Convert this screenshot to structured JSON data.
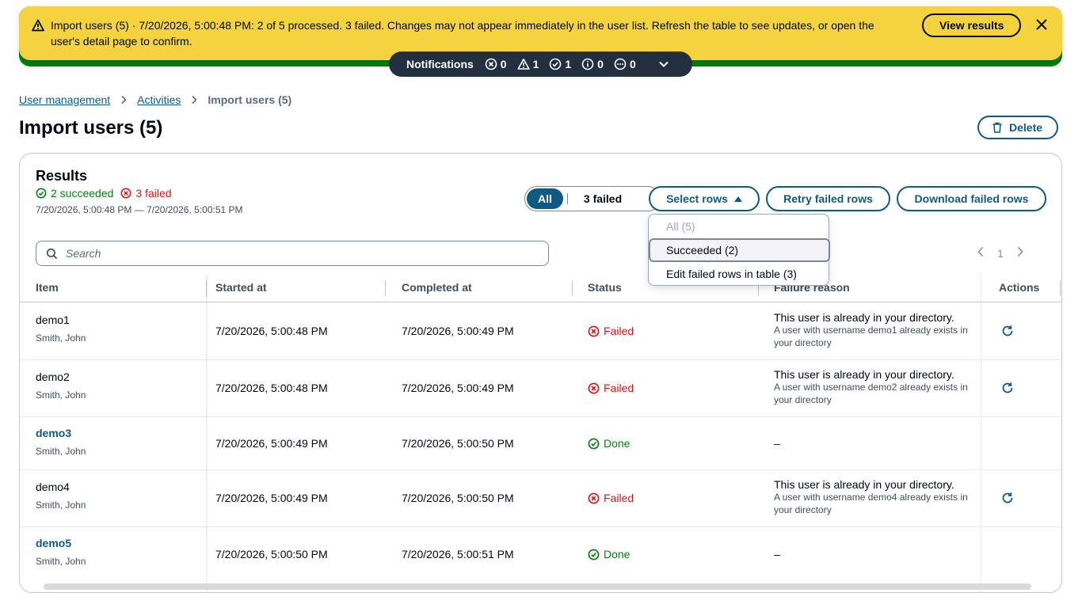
{
  "flash": {
    "text": "Import users (5) · 7/20/2026, 5:00:48 PM: 2 of 5 processed. 3 failed. Changes may not appear immediately in the user list. Refresh the table to see updates, or open the user's detail page to confirm.",
    "action_label": "View results",
    "icon": "warning-icon",
    "background": "#f5d33f"
  },
  "notifications": {
    "label": "Notifications",
    "counts": {
      "error": "0",
      "warning": "1",
      "success": "1",
      "info": "0",
      "in_progress": "0"
    }
  },
  "breadcrumb": {
    "items": [
      "User management",
      "Activities"
    ],
    "current": "Import users (5)"
  },
  "page": {
    "title": "Import users (5)",
    "delete_label": "Delete"
  },
  "results": {
    "title": "Results",
    "succeeded": "2 succeeded",
    "failed": "3 failed",
    "range": "7/20/2026, 5:00:48 PM — 7/20/2026, 5:00:51 PM",
    "segments": [
      "All",
      "3 failed"
    ],
    "select_rows_label": "Select rows",
    "retry_label": "Retry failed rows",
    "download_label": "Download failed rows",
    "search_placeholder": "Search",
    "page_number": "1"
  },
  "dropdown": {
    "items": [
      "All (5)",
      "Succeeded (2)",
      "Edit failed rows in table (3)"
    ]
  },
  "table": {
    "headers": [
      "Item",
      "Started at",
      "Completed at",
      "Status",
      "Failure reason",
      "Actions"
    ],
    "rows": [
      {
        "item": "demo1",
        "owner": "Smith, John",
        "started": "7/20/2026, 5:00:48 PM",
        "completed": "7/20/2026, 5:00:49 PM",
        "status": "Failed",
        "reason_title": "This user is already in your directory.",
        "reason_detail": "A user with username demo1 already exists in your directory"
      },
      {
        "item": "demo2",
        "owner": "Smith, John",
        "started": "7/20/2026, 5:00:48 PM",
        "completed": "7/20/2026, 5:00:49 PM",
        "status": "Failed",
        "reason_title": "This user is already in your directory.",
        "reason_detail": "A user with username demo2 already exists in your directory"
      },
      {
        "item": "demo3",
        "owner": "Smith, John",
        "started": "7/20/2026, 5:00:49 PM",
        "completed": "7/20/2026, 5:00:50 PM",
        "status": "Done",
        "reason_title": "–",
        "reason_detail": ""
      },
      {
        "item": "demo4",
        "owner": "Smith, John",
        "started": "7/20/2026, 5:00:49 PM",
        "completed": "7/20/2026, 5:00:50 PM",
        "status": "Failed",
        "reason_title": "This user is already in your directory.",
        "reason_detail": "A user with username demo4 already exists in your directory"
      },
      {
        "item": "demo5",
        "owner": "Smith, John",
        "started": "7/20/2026, 5:00:50 PM",
        "completed": "7/20/2026, 5:00:51 PM",
        "status": "Done",
        "reason_title": "–",
        "reason_detail": ""
      }
    ]
  },
  "colors": {
    "accent": "#0f5a82",
    "success": "#037f0c",
    "error": "#d91515",
    "notif_bg": "#232f3e"
  }
}
